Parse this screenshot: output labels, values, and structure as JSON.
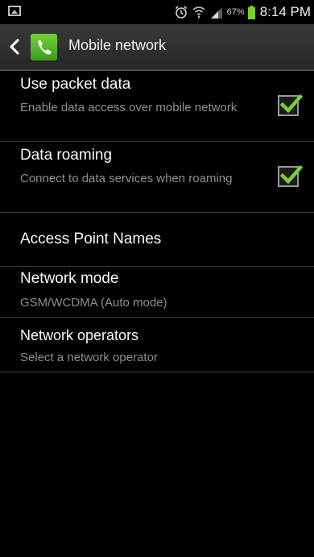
{
  "status_bar": {
    "battery_percent": "67%",
    "time": "8:14 PM"
  },
  "action_bar": {
    "title": "Mobile network"
  },
  "settings": [
    {
      "title": "Use packet data",
      "subtitle": "Enable data access over mobile network",
      "checked": true
    },
    {
      "title": "Data roaming",
      "subtitle": "Connect to data services when roaming",
      "checked": true
    },
    {
      "title": "Access Point Names"
    },
    {
      "title": "Network mode",
      "subtitle": "GSM/WCDMA (Auto mode)"
    },
    {
      "title": "Network operators",
      "subtitle": "Select a network operator"
    }
  ],
  "colors": {
    "check_green": "#7ad12e",
    "app_icon_green": "#4caf2a"
  }
}
